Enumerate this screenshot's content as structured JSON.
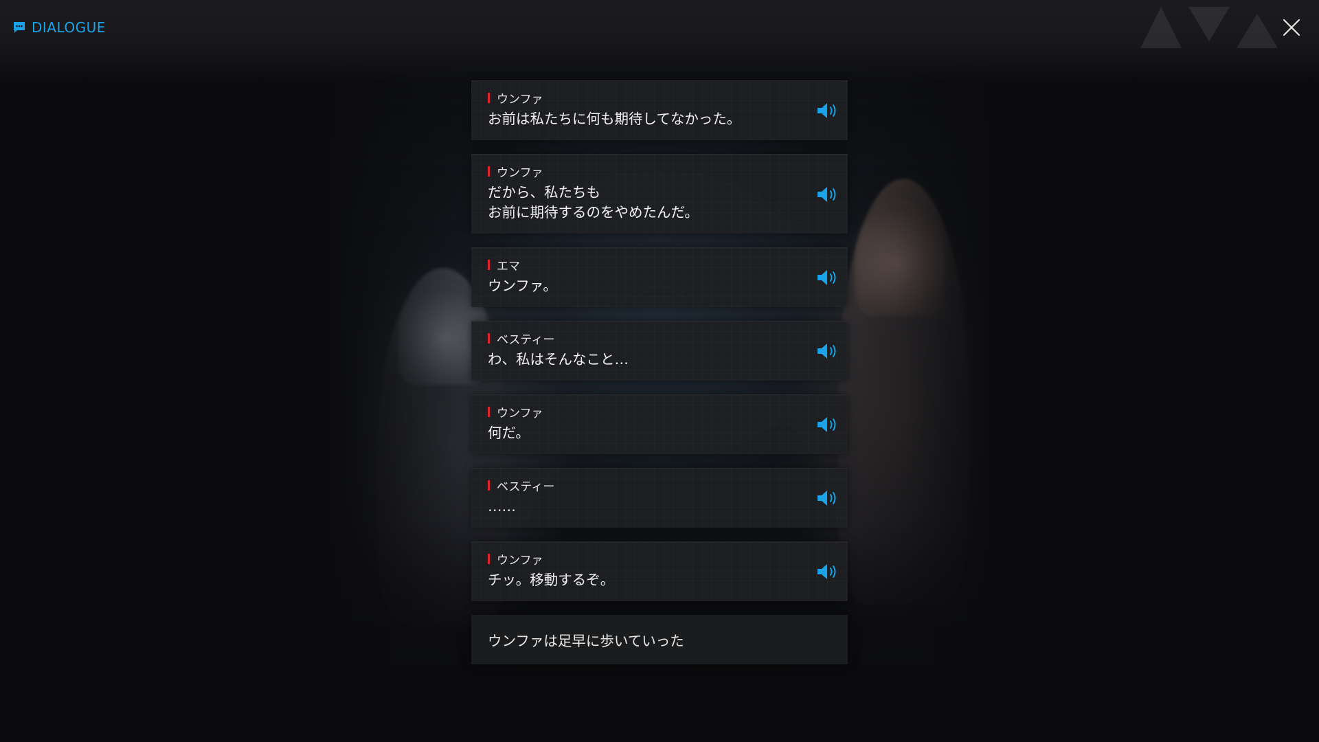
{
  "header": {
    "title": "DIALOGUE",
    "title_icon": "chat-bubble-icon",
    "close_icon": "close-icon",
    "accent_color": "#1aa3e8"
  },
  "dialogue": [
    {
      "speaker": "ウンファ",
      "lines": [
        "お前は私たちに何も期待してなかった。"
      ],
      "voice_icon": "speaker-voice-icon"
    },
    {
      "speaker": "ウンファ",
      "lines": [
        "だから、私たちも",
        "お前に期待するのをやめたんだ。"
      ],
      "voice_icon": "speaker-voice-icon"
    },
    {
      "speaker": "エマ",
      "lines": [
        "ウンファ。"
      ],
      "voice_icon": "speaker-voice-icon"
    },
    {
      "speaker": "ベスティー",
      "lines": [
        "わ、私はそんなこと…"
      ],
      "voice_icon": "speaker-voice-icon"
    },
    {
      "speaker": "ウンファ",
      "lines": [
        "何だ。"
      ],
      "voice_icon": "speaker-voice-icon"
    },
    {
      "speaker": "ベスティー",
      "lines": [
        "……"
      ],
      "voice_icon": "speaker-voice-icon"
    },
    {
      "speaker": "ウンファ",
      "lines": [
        "チッ。移動するぞ。"
      ],
      "voice_icon": "speaker-voice-icon"
    }
  ],
  "narration": "ウンファは足早に歩いていった",
  "colors": {
    "speaker_mark": "#e0262c",
    "voice_icon": "#1aa3e8"
  }
}
